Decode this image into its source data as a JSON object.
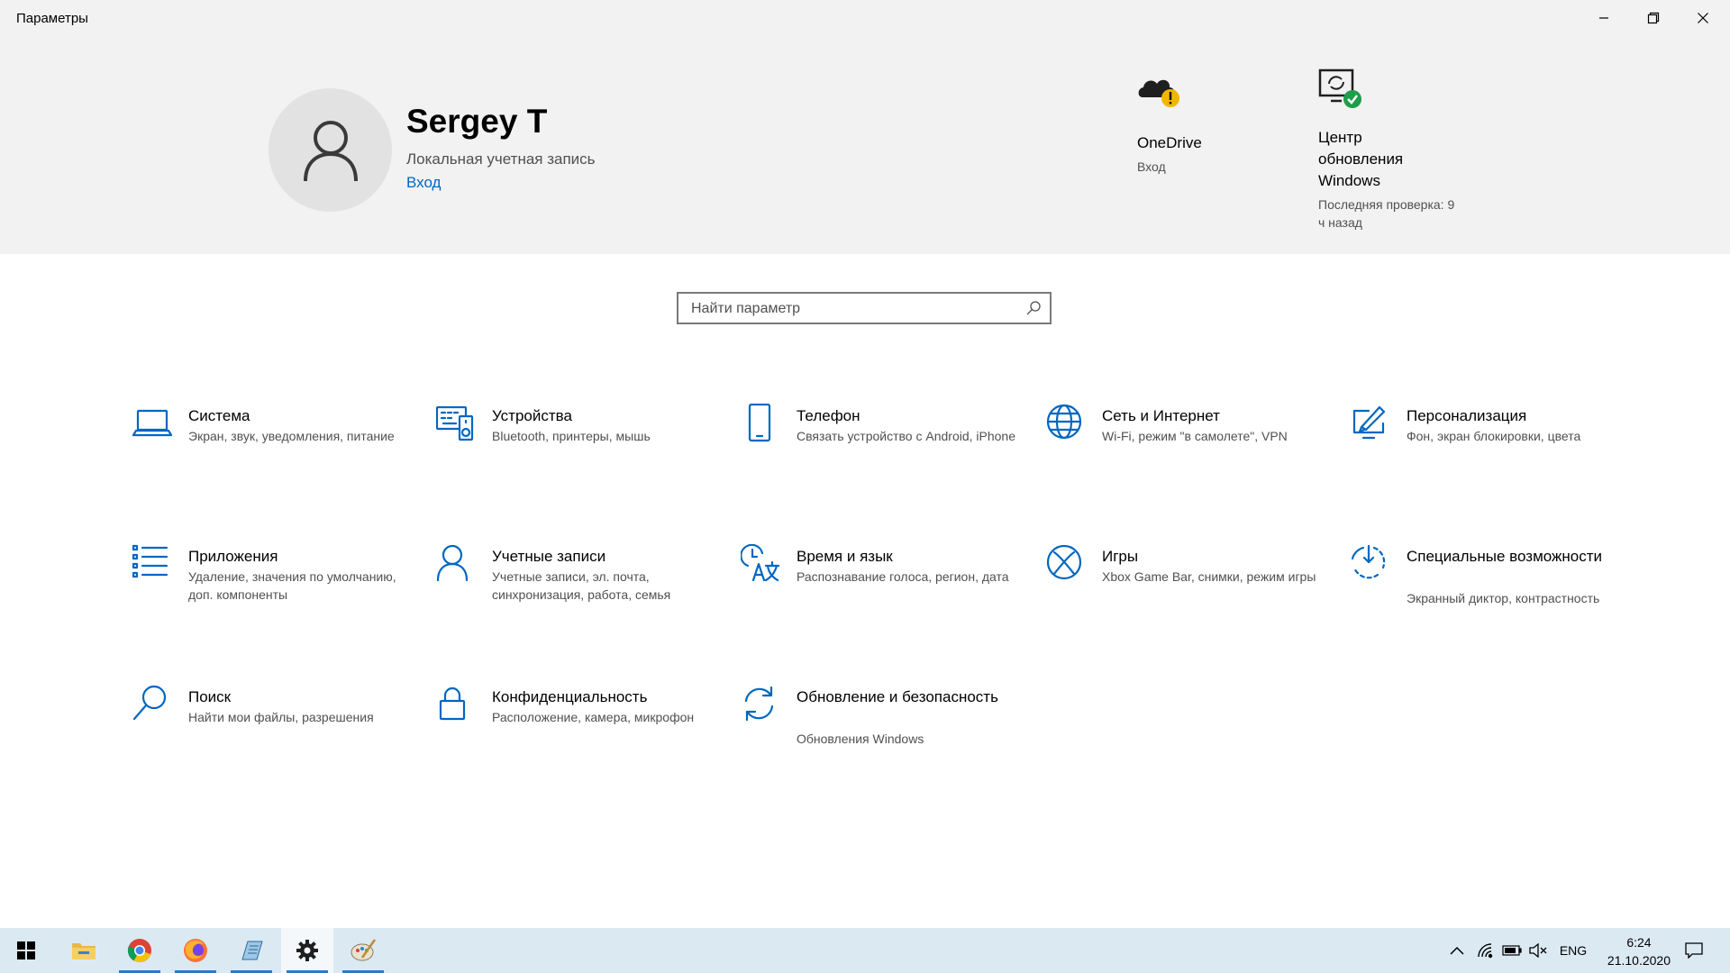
{
  "window": {
    "title": "Параметры",
    "controls": [
      "minimize-icon",
      "restore-icon",
      "close-icon"
    ]
  },
  "profile": {
    "name": "Sergey T",
    "account_type": "Локальная учетная запись",
    "sign_in_link": "Вход"
  },
  "header_tiles": [
    {
      "title": "OneDrive",
      "status": "Вход",
      "icon": "onedrive-warning-icon"
    },
    {
      "title": "Центр обновления Windows",
      "status": "Последняя проверка: 9 ч назад",
      "icon": "windows-update-ok-icon"
    }
  ],
  "search": {
    "placeholder": "Найти параметр"
  },
  "categories": [
    {
      "name": "Система",
      "desc": "Экран, звук, уведомления, питание",
      "icon": "laptop-icon"
    },
    {
      "name": "Устройства",
      "desc": "Bluetooth, принтеры, мышь",
      "icon": "devices-icon"
    },
    {
      "name": "Телефон",
      "desc": "Связать устройство с Android, iPhone",
      "icon": "phone-icon"
    },
    {
      "name": "Сеть и Интернет",
      "desc": "Wi-Fi, режим \"в самолете\", VPN",
      "icon": "globe-icon"
    },
    {
      "name": "Персонализация",
      "desc": "Фон, экран блокировки, цвета",
      "icon": "personalization-icon"
    },
    {
      "name": "Приложения",
      "desc": "Удаление, значения по умолчанию, доп. компоненты",
      "icon": "apps-list-icon"
    },
    {
      "name": "Учетные записи",
      "desc": "Учетные записи, эл. почта, синхронизация, работа, семья",
      "icon": "person-icon"
    },
    {
      "name": "Время и язык",
      "desc": "Распознавание голоса, регион, дата",
      "icon": "time-language-icon"
    },
    {
      "name": "Игры",
      "desc": "Xbox Game Bar, снимки, режим игры",
      "icon": "xbox-icon"
    },
    {
      "name": "Специальные возможности",
      "desc": "Экранный диктор, контрастность",
      "icon": "accessibility-icon"
    },
    {
      "name": "Поиск",
      "desc": "Найти мои файлы, разрешения",
      "icon": "search-magnifier-icon"
    },
    {
      "name": "Конфиденциальность",
      "desc": "Расположение, камера, микрофон",
      "icon": "lock-icon"
    },
    {
      "name": "Обновление и безопасность",
      "desc": "Обновления Windows",
      "icon": "sync-icon"
    }
  ],
  "taskbar": {
    "apps": [
      "start-icon",
      "file-explorer-icon",
      "chrome-icon",
      "firefox-icon",
      "notepad-icon",
      "settings-gear-icon",
      "paint-icon"
    ],
    "tray": {
      "language": "ENG",
      "time": "6:24",
      "date": "21.10.2020"
    },
    "colors": {
      "background": "#dbe9f3",
      "indicator": "#2a7acc"
    }
  },
  "colors": {
    "accent": "#0067c0",
    "header_bg": "#f2f2f2",
    "secondary_text": "#505050"
  }
}
